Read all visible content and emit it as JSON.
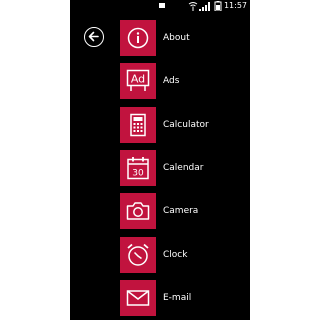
{
  "status_bar": {
    "time": "11:57",
    "icons": [
      "notification-icon",
      "wifi-icon",
      "signal-icon",
      "battery-icon"
    ]
  },
  "navigation": {
    "back_icon": "back-arrow-icon"
  },
  "apps": [
    {
      "label": "About",
      "icon": "info-icon"
    },
    {
      "label": "Ads",
      "icon": "ad-icon"
    },
    {
      "label": "Calculator",
      "icon": "calculator-icon"
    },
    {
      "label": "Calendar",
      "icon": "calendar-icon",
      "icon_text": "30"
    },
    {
      "label": "Camera",
      "icon": "camera-icon"
    },
    {
      "label": "Clock",
      "icon": "clock-icon"
    },
    {
      "label": "E-mail",
      "icon": "mail-icon"
    }
  ],
  "colors": {
    "accent": "#c1133e",
    "background": "#000000",
    "text": "#ffffff"
  }
}
